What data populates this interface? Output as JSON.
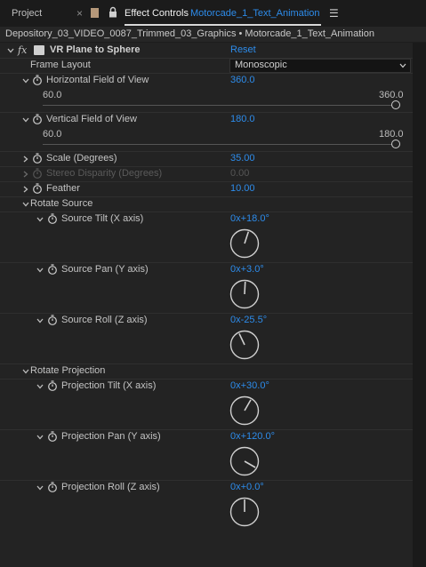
{
  "tabs": {
    "project": "Project",
    "effect_controls": "Effect Controls",
    "composition": "Motorcade_1_Text_Animation"
  },
  "breadcrumb": "Depository_03_VIDEO_0087_Trimmed_03_Graphics • Motorcade_1_Text_Animation",
  "effect": {
    "fx": "fx",
    "name": "VR Plane to Sphere",
    "reset": "Reset",
    "frame_layout_label": "Frame Layout",
    "frame_layout_value": "Monoscopic"
  },
  "hfov": {
    "label": "Horizontal Field of View",
    "value": "360.0",
    "min": "60.0",
    "max": "360.0",
    "fraction": 1.0
  },
  "vfov": {
    "label": "Vertical Field of View",
    "value": "180.0",
    "min": "60.0",
    "max": "180.0",
    "fraction": 1.0
  },
  "scale": {
    "label": "Scale (Degrees)",
    "value": "35.00"
  },
  "stereo": {
    "label": "Stereo Disparity (Degrees)",
    "value": "0.00"
  },
  "feather": {
    "label": "Feather",
    "value": "10.00"
  },
  "rotate_source": {
    "label": "Rotate Source",
    "tilt": {
      "label": "Source Tilt (X axis)",
      "value": "0x+18.0°",
      "angle": 18.0
    },
    "pan": {
      "label": "Source Pan (Y axis)",
      "value": "0x+3.0°",
      "angle": 3.0
    },
    "roll": {
      "label": "Source Roll (Z axis)",
      "value": "0x-25.5°",
      "angle": -25.5
    }
  },
  "rotate_projection": {
    "label": "Rotate Projection",
    "tilt": {
      "label": "Projection Tilt (X axis)",
      "value": "0x+30.0°",
      "angle": 30.0
    },
    "pan": {
      "label": "Projection Pan (Y axis)",
      "value": "0x+120.0°",
      "angle": 120.0
    },
    "roll": {
      "label": "Projection Roll (Z axis)",
      "value": "0x+0.0°",
      "angle": 0.0
    }
  },
  "colors": {
    "accent": "#2d8ceb",
    "panel": "#232323",
    "text": "#c4c4c4"
  }
}
